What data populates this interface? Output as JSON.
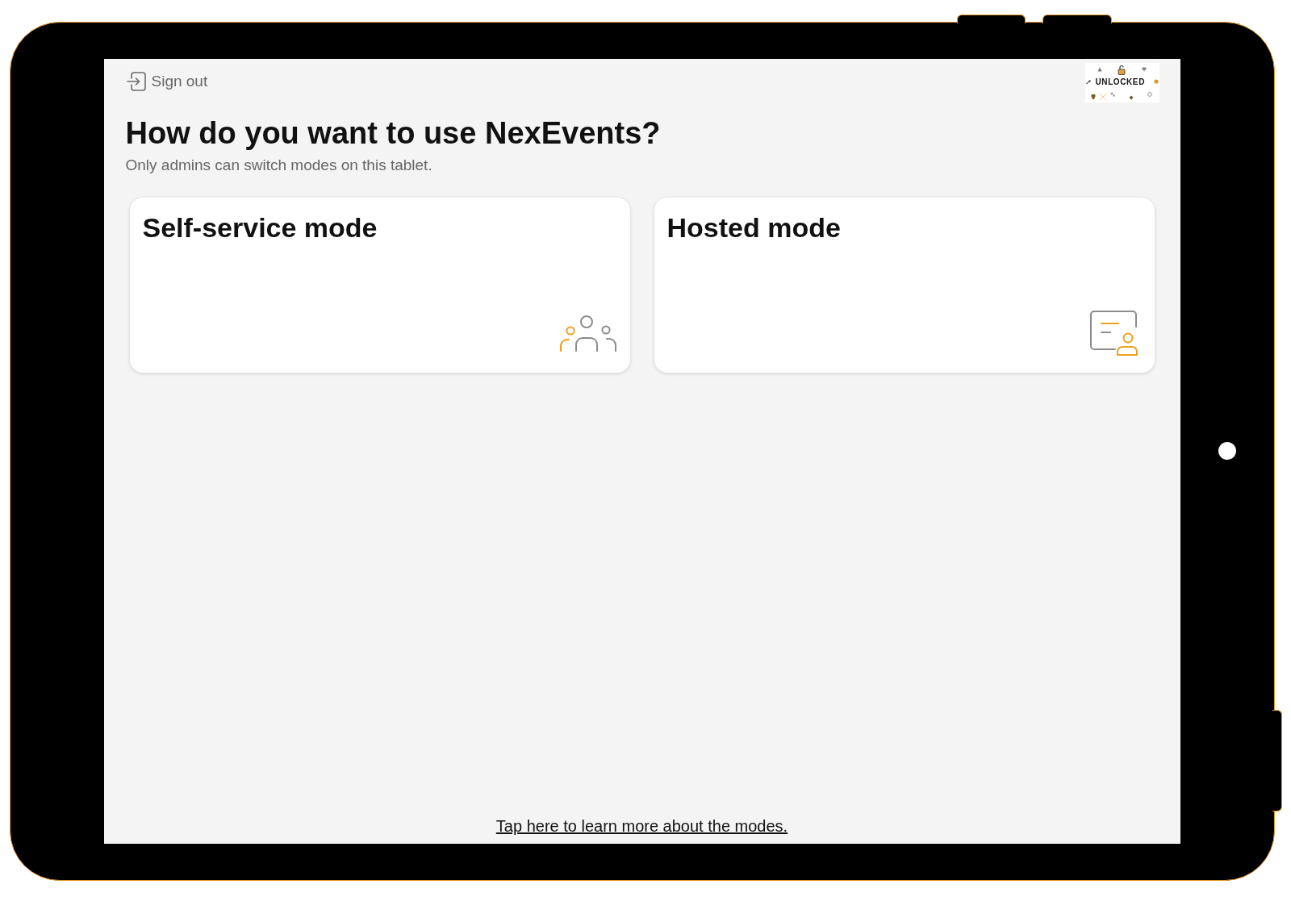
{
  "top_bar": {
    "sign_out": {
      "label": "Sign out"
    },
    "status_sticker": {
      "label": "UNLOCKED"
    }
  },
  "heading": {
    "title": "How do you want to use NexEvents?",
    "subtitle": "Only admins can switch modes on this tablet."
  },
  "modes": [
    {
      "title": "Self-service mode",
      "kind": "self-service"
    },
    {
      "title": "Hosted mode",
      "kind": "hosted"
    }
  ],
  "footer_link": "Tap here to learn more about the modes."
}
